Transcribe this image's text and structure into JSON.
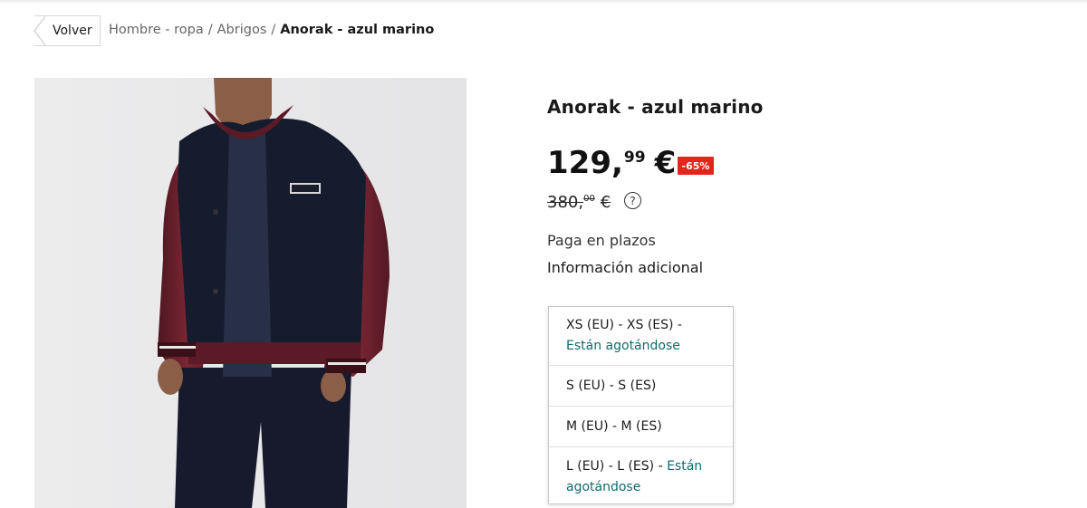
{
  "breadcrumb": {
    "back_label": "Volver",
    "items": [
      "Hombre - ropa",
      "Abrigos"
    ],
    "separator": "/",
    "current": "Anorak - azul marino"
  },
  "product": {
    "title": "Anorak - azul marino",
    "price": {
      "integer": "129,",
      "decimal": "99",
      "currency": "€"
    },
    "discount": "-65%",
    "old_price": {
      "integer": "380,",
      "decimal": "00",
      "currency": "€"
    },
    "help_glyph": "?",
    "pay_installments": "Paga en plazos",
    "additional_info": "Información adicional"
  },
  "sizes": [
    {
      "label": "XS (EU) - XS (ES) - ",
      "stock": "Están agotándose"
    },
    {
      "label": "S (EU) - S (ES)",
      "stock": ""
    },
    {
      "label": "M (EU) - M (ES)",
      "stock": ""
    },
    {
      "label": "L (EU) - L (ES) - ",
      "stock": "Están agotándose"
    }
  ],
  "colors": {
    "discount": "#e2261c",
    "low_stock": "#0f6a6b"
  },
  "icons": {
    "back": "chevron-left-icon",
    "help": "question-circle-icon"
  }
}
